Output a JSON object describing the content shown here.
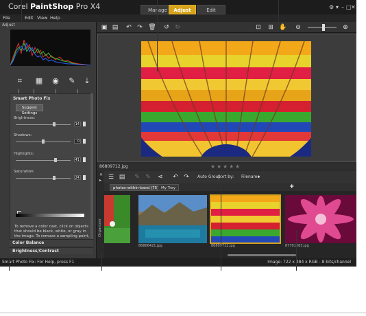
{
  "app": {
    "title_prefix": "Corel ",
    "title_brand": "PaintShop",
    "title_suffix": " Pro X4",
    "workspace_tabs": [
      "Manage",
      "Adjust",
      "Edit"
    ],
    "active_tab": "Adjust",
    "window_controls": [
      "⚙",
      "▾",
      "–",
      "□",
      "✕"
    ]
  },
  "menubar": [
    "File",
    "Edit",
    "View",
    "Help"
  ],
  "left_panel": {
    "label": "Adjust",
    "smart_photo_fix": {
      "title": "Smart Photo Fix",
      "suggest_button": "Suggest Settings",
      "sliders": [
        {
          "label": "Brightness:",
          "value": "14",
          "level": 0.7
        },
        {
          "label": "Shadows:",
          "value": "0",
          "level": 0.5
        },
        {
          "label": "Highlights:",
          "value": "41",
          "level": 0.72
        },
        {
          "label": "Saturation:",
          "value": "24",
          "level": 0.7
        }
      ],
      "help_text": "To remove a color cast, click on objects that should be black, white, or gray in the image. To remove a sampling point, click on it."
    },
    "collapsed_panels": [
      "Color Balance",
      "Brightness/Contrast"
    ]
  },
  "info_strip": {
    "filename": "86809712.jpg"
  },
  "organizer": {
    "side_label": "Organizer",
    "auto_group": "Auto Group",
    "sort_by": "Sort by:",
    "sort_value": "Filename",
    "tabs": [
      "photos-within-band (75)",
      "My Tray"
    ],
    "add_tab": "+",
    "thumbnails": [
      {
        "label": ""
      },
      {
        "label": "86806421.jpg"
      },
      {
        "label": "86809712.jpg"
      },
      {
        "label": "87701063.jpg"
      }
    ]
  },
  "statusbar": {
    "left": "Smart Photo Fix: For Help, press F1",
    "right": "Image: 722 x 484 x RGB - 8 bits/channel"
  },
  "colors": {
    "accent": "#d6a31a",
    "background": "#2b2b2b"
  }
}
